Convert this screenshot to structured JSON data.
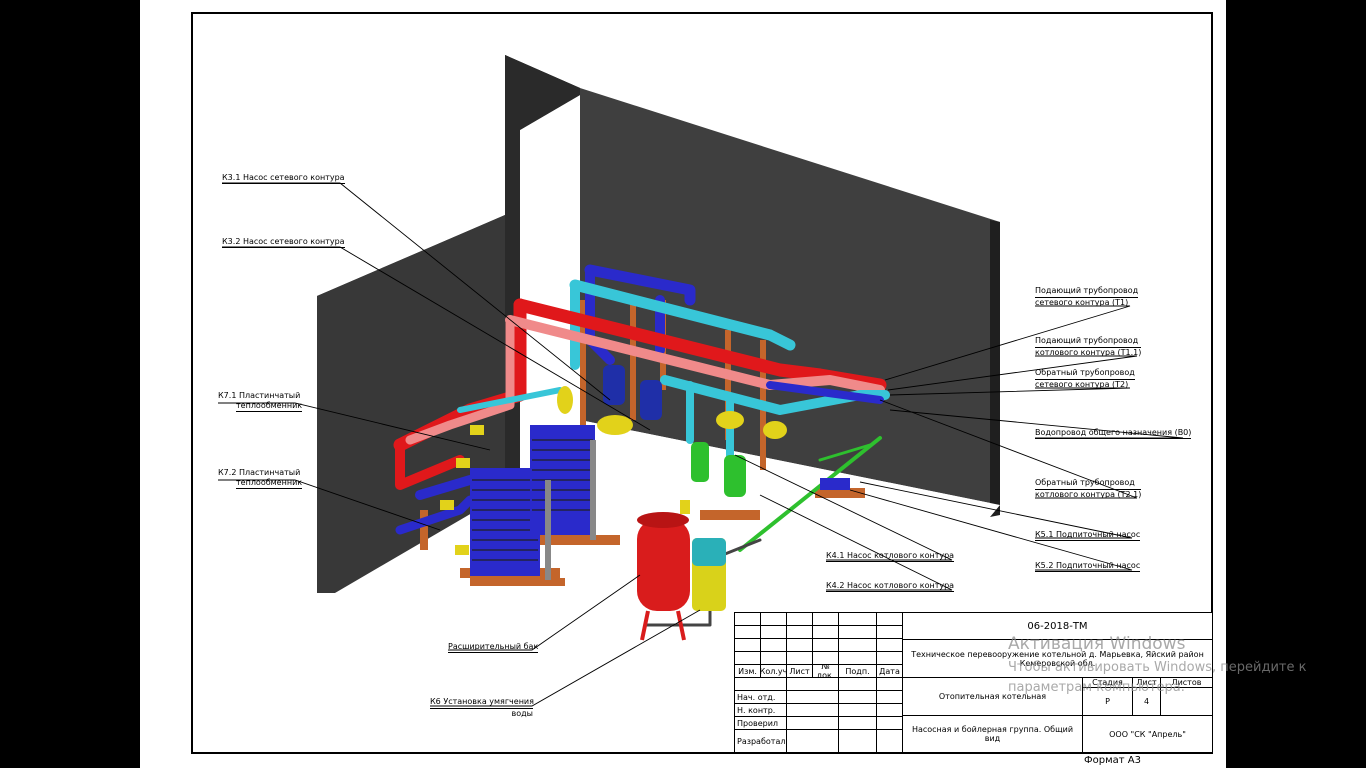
{
  "drawing": {
    "code": "06-2018-ТМ",
    "project_title": "Техническое перевооружение котельной д. Марьевка, Яйский район Кемеровской обл.",
    "object_name": "Отопительная котельная",
    "sheet_name": "Насосная и бойлерная группа. Общий вид",
    "company": "ООО \"СК \"Апрель\"",
    "stage_header": "Стадия",
    "sheet_header": "Лист",
    "sheets_header": "Листов",
    "stage_value": "Р",
    "sheet_value": "4",
    "sheets_value": "",
    "format": "Формат А3"
  },
  "revision_headers": [
    "Изм.",
    "Кол.уч",
    "Лист",
    "№ док.",
    "Подп.",
    "Дата"
  ],
  "signature_rows": [
    "Нач. отд.",
    "Н. контр.",
    "Проверил",
    "Разработал"
  ],
  "callouts": {
    "k31": "К3.1 Насос сетевого контура",
    "k32": "К3.2 Насос сетевого контура",
    "k71_line1": "К7.1 Пластинчатый",
    "k71_line2": "теплообменник",
    "k72_line1": "К7.2 Пластинчатый",
    "k72_line2": "теплообменник",
    "tank": "Расширительный бак",
    "k6_line1": "К6 Установка умягчения",
    "k6_line2": "воды",
    "t1_line1": "Подающий трубопровод",
    "t1_line2": "сетевого контура (Т1)",
    "t11_line1": "Подающий трубопровод",
    "t11_line2": "котлового контура (Т1.1)",
    "t2_line1": "Обратный трубопровод",
    "t2_line2": "сетевого контура (Т2)",
    "b0": "Водопровод общего назначения (В0)",
    "t21_line1": "Обратный трубопровод",
    "t21_line2": "котлового контура (Т2.1)",
    "k51": "К5.1 Подпиточный насос",
    "k52": "К5.2 Подпиточный насос",
    "k41": "К4.1 Насос котлового контура",
    "k42": "К4.2 Насос котлового контура"
  },
  "watermark": {
    "line1": "Активация Windows",
    "line2": "Чтобы активировать Windows, перейдите к параметрам компьютера."
  },
  "colors": {
    "supply_network": "#e0181b",
    "supply_boiler": "#f08a8a",
    "return_network": "#2a2acb",
    "return_boiler": "#38c6d8",
    "water_supply": "#2ec02e",
    "wall": "#3b3b3b",
    "frame_wood": "#c4652b",
    "tank": "#d91c1c"
  }
}
